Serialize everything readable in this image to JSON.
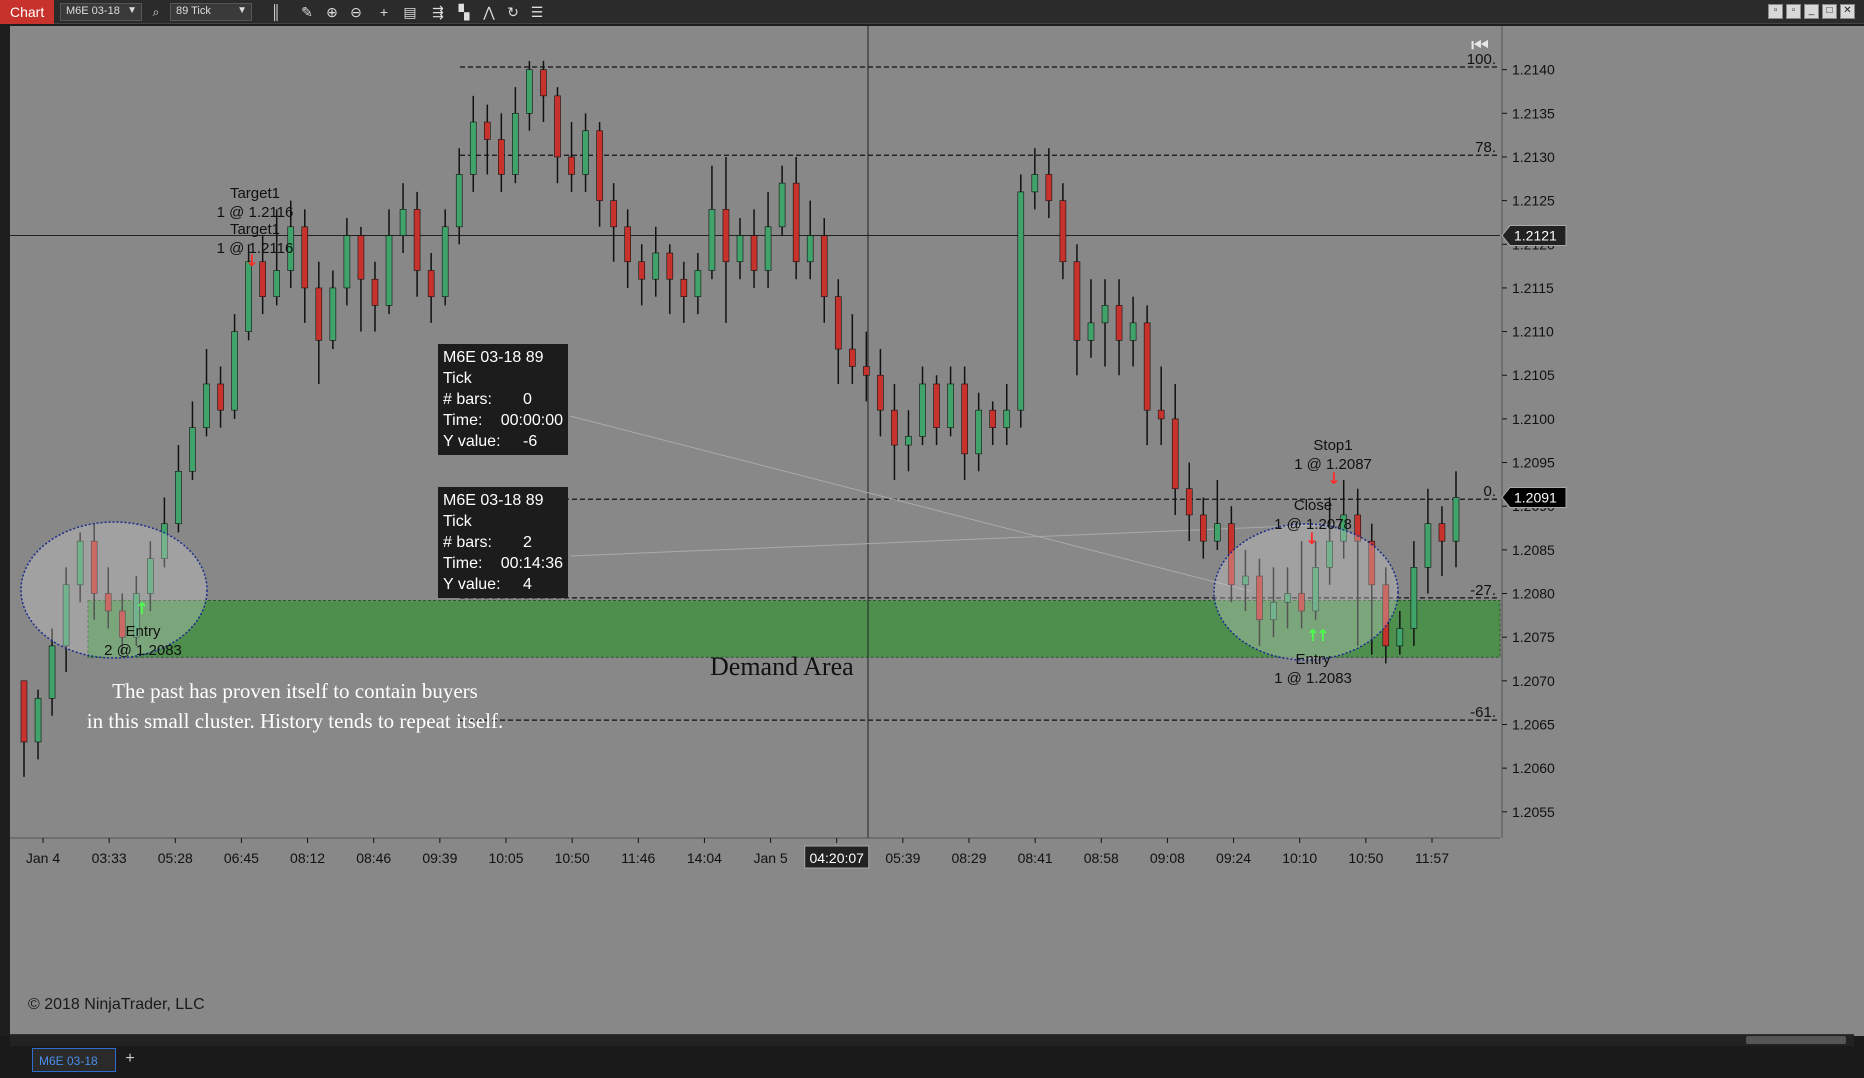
{
  "toolbar": {
    "chart_tab": "Chart",
    "instrument": "M6E 03-18",
    "period": "89 Tick",
    "icons": [
      "bar-type-icon",
      "pencil-icon",
      "zoom-in-icon",
      "zoom-out-icon",
      "crosshair-icon",
      "properties-icon",
      "strategies-icon",
      "indicators-icon",
      "drawing-tools-icon",
      "refresh-icon",
      "list-icon"
    ],
    "window_buttons": [
      "restore",
      "tile",
      "minimize",
      "maximize",
      "close"
    ]
  },
  "colors": {
    "up": "#3fa36a",
    "down": "#c8322c",
    "background": "#888888",
    "demand_area": "#4e8f4e"
  },
  "chart_data": {
    "type": "candlestick",
    "y_ticks": [
      "1.2140",
      "1.2135",
      "1.2130",
      "1.2125",
      "1.2120",
      "1.2115",
      "1.2110",
      "1.2105",
      "1.2100",
      "1.2095",
      "1.2090",
      "1.2085",
      "1.2080",
      "1.2075",
      "1.2070",
      "1.2065",
      "1.2060",
      "1.2055"
    ],
    "ylim": [
      1.2052,
      1.2145
    ],
    "x_ticks": [
      "Jan 4",
      "03:33",
      "05:28",
      "06:45",
      "08:12",
      "08:46",
      "09:39",
      "10:05",
      "10:50",
      "11:46",
      "14:04",
      "Jan 5",
      "04:20:07",
      "05:39",
      "08:29",
      "08:41",
      "08:58",
      "09:08",
      "09:24",
      "10:10",
      "10:50",
      "11:57"
    ],
    "price_marker": "1.2121",
    "last_price": "1.2091",
    "fib_labels": [
      "100.",
      "78.",
      "0.",
      "-27.",
      "-61."
    ],
    "fib_levels": [
      1.21403,
      1.21302,
      1.20908,
      1.20795,
      1.20655
    ],
    "demand_area": {
      "label": "Demand Area",
      "low": 1.20727,
      "high": 1.20792
    },
    "candles": [
      [
        1.207,
        1.2063,
        1.2068,
        1.2059
      ],
      [
        1.2063,
        1.2068,
        1.2069,
        1.2061
      ],
      [
        1.2068,
        1.2074,
        1.2076,
        1.2066
      ],
      [
        1.2074,
        1.2081,
        1.2083,
        1.2071
      ],
      [
        1.2081,
        1.2086,
        1.2087,
        1.2079
      ],
      [
        1.2086,
        1.208,
        1.2088,
        1.2077
      ],
      [
        1.208,
        1.2078,
        1.2083,
        1.2076
      ],
      [
        1.2078,
        1.2075,
        1.208,
        1.2073
      ],
      [
        1.2075,
        1.208,
        1.2082,
        1.2074
      ],
      [
        1.208,
        1.2084,
        1.2086,
        1.2078
      ],
      [
        1.2084,
        1.2088,
        1.2091,
        1.2083
      ],
      [
        1.2088,
        1.2094,
        1.2097,
        1.2087
      ],
      [
        1.2094,
        1.2099,
        1.2102,
        1.2093
      ],
      [
        1.2099,
        1.2104,
        1.2108,
        1.2098
      ],
      [
        1.2104,
        1.2101,
        1.2106,
        1.2099
      ],
      [
        1.2101,
        1.211,
        1.2112,
        1.21
      ],
      [
        1.211,
        1.2118,
        1.212,
        1.2109
      ],
      [
        1.2118,
        1.2114,
        1.2121,
        1.2112
      ],
      [
        1.2114,
        1.2117,
        1.2124,
        1.2113
      ],
      [
        1.2117,
        1.2122,
        1.2125,
        1.2115
      ],
      [
        1.2122,
        1.2115,
        1.2124,
        1.2111
      ],
      [
        1.2115,
        1.2109,
        1.2118,
        1.2104
      ],
      [
        1.2109,
        1.2115,
        1.2117,
        1.2108
      ],
      [
        1.2115,
        1.2121,
        1.2123,
        1.2113
      ],
      [
        1.2121,
        1.2116,
        1.2122,
        1.211
      ],
      [
        1.2116,
        1.2113,
        1.2118,
        1.211
      ],
      [
        1.2113,
        1.2121,
        1.2124,
        1.2112
      ],
      [
        1.2121,
        1.2124,
        1.2127,
        1.2119
      ],
      [
        1.2124,
        1.2117,
        1.2126,
        1.2114
      ],
      [
        1.2117,
        1.2114,
        1.2119,
        1.2111
      ],
      [
        1.2114,
        1.2122,
        1.2124,
        1.2113
      ],
      [
        1.2122,
        1.2128,
        1.2131,
        1.212
      ],
      [
        1.2128,
        1.2134,
        1.2137,
        1.2126
      ],
      [
        1.2134,
        1.2132,
        1.2136,
        1.2128
      ],
      [
        1.2132,
        1.2128,
        1.2135,
        1.2126
      ],
      [
        1.2128,
        1.2135,
        1.2138,
        1.2127
      ],
      [
        1.2135,
        1.214,
        1.2141,
        1.2133
      ],
      [
        1.214,
        1.2137,
        1.2141,
        1.2134
      ],
      [
        1.2137,
        1.213,
        1.2138,
        1.2127
      ],
      [
        1.213,
        1.2128,
        1.2134,
        1.2126
      ],
      [
        1.2128,
        1.2133,
        1.2135,
        1.2126
      ],
      [
        1.2133,
        1.2125,
        1.2134,
        1.2122
      ],
      [
        1.2125,
        1.2122,
        1.2127,
        1.2118
      ],
      [
        1.2122,
        1.2118,
        1.2124,
        1.2115
      ],
      [
        1.2118,
        1.2116,
        1.212,
        1.2113
      ],
      [
        1.2116,
        1.2119,
        1.2122,
        1.2114
      ],
      [
        1.2119,
        1.2116,
        1.212,
        1.2112
      ],
      [
        1.2116,
        1.2114,
        1.2118,
        1.2111
      ],
      [
        1.2114,
        1.2117,
        1.2119,
        1.2112
      ],
      [
        1.2117,
        1.2124,
        1.2129,
        1.2116
      ],
      [
        1.2124,
        1.2118,
        1.213,
        1.2111
      ],
      [
        1.2118,
        1.2121,
        1.2123,
        1.2116
      ],
      [
        1.2121,
        1.2117,
        1.2124,
        1.2115
      ],
      [
        1.2117,
        1.2122,
        1.2126,
        1.2115
      ],
      [
        1.2122,
        1.2127,
        1.2129,
        1.2121
      ],
      [
        1.2127,
        1.2118,
        1.213,
        1.2116
      ],
      [
        1.2118,
        1.2121,
        1.2125,
        1.2116
      ],
      [
        1.2121,
        1.2114,
        1.2123,
        1.2111
      ],
      [
        1.2114,
        1.2108,
        1.2116,
        1.2104
      ],
      [
        1.2108,
        1.2106,
        1.2112,
        1.2104
      ],
      [
        1.2106,
        1.2105,
        1.211,
        1.2102
      ],
      [
        1.2105,
        1.2101,
        1.2108,
        1.2098
      ],
      [
        1.2101,
        1.2097,
        1.2104,
        1.2093
      ],
      [
        1.2097,
        1.2098,
        1.2101,
        1.2094
      ],
      [
        1.2098,
        1.2104,
        1.2106,
        1.2097
      ],
      [
        1.2104,
        1.2099,
        1.2105,
        1.2097
      ],
      [
        1.2099,
        1.2104,
        1.2106,
        1.2098
      ],
      [
        1.2104,
        1.2096,
        1.2106,
        1.2093
      ],
      [
        1.2096,
        1.2101,
        1.2103,
        1.2094
      ],
      [
        1.2101,
        1.2099,
        1.2102,
        1.2097
      ],
      [
        1.2099,
        1.2101,
        1.2104,
        1.2097
      ],
      [
        1.2101,
        1.2126,
        1.2128,
        1.2099
      ],
      [
        1.2126,
        1.2128,
        1.2131,
        1.2124
      ],
      [
        1.2128,
        1.2125,
        1.2131,
        1.2123
      ],
      [
        1.2125,
        1.2118,
        1.2127,
        1.2116
      ],
      [
        1.2118,
        1.2109,
        1.212,
        1.2105
      ],
      [
        1.2109,
        1.2111,
        1.2116,
        1.2107
      ],
      [
        1.2111,
        1.2113,
        1.2116,
        1.2106
      ],
      [
        1.2113,
        1.2109,
        1.2116,
        1.2105
      ],
      [
        1.2109,
        1.2111,
        1.2114,
        1.2106
      ],
      [
        1.2111,
        1.2101,
        1.2113,
        1.2097
      ],
      [
        1.2101,
        1.21,
        1.2106,
        1.2097
      ],
      [
        1.21,
        1.2092,
        1.2104,
        1.2089
      ],
      [
        1.2092,
        1.2089,
        1.2095,
        1.2086
      ],
      [
        1.2089,
        1.2086,
        1.2091,
        1.2084
      ],
      [
        1.2086,
        1.2088,
        1.2093,
        1.2085
      ],
      [
        1.2088,
        1.2081,
        1.209,
        1.2079
      ],
      [
        1.2081,
        1.2082,
        1.2085,
        1.2078
      ],
      [
        1.2082,
        1.2077,
        1.2084,
        1.2074
      ],
      [
        1.2077,
        1.2079,
        1.2083,
        1.2075
      ],
      [
        1.2079,
        1.208,
        1.2083,
        1.2076
      ],
      [
        1.208,
        1.2078,
        1.2086,
        1.2076
      ],
      [
        1.2078,
        1.2083,
        1.2086,
        1.2077
      ],
      [
        1.2083,
        1.2086,
        1.2091,
        1.2081
      ],
      [
        1.2086,
        1.2089,
        1.2093,
        1.2084
      ],
      [
        1.2089,
        1.2086,
        1.2092,
        1.2074
      ],
      [
        1.2086,
        1.2081,
        1.2088,
        1.2073
      ],
      [
        1.2081,
        1.2074,
        1.2083,
        1.2072
      ],
      [
        1.2074,
        1.2076,
        1.2078,
        1.2073
      ],
      [
        1.2076,
        1.2083,
        1.2086,
        1.2074
      ],
      [
        1.2083,
        1.2088,
        1.2092,
        1.208
      ],
      [
        1.2088,
        1.2086,
        1.209,
        1.2082
      ],
      [
        1.2086,
        1.2091,
        1.2094,
        1.2083
      ]
    ]
  },
  "labels": {
    "copyright": "© 2018 NinjaTrader, LLC",
    "demand_area": "Demand Area",
    "comment_line1": "The past has proven itself to contain buyers",
    "comment_line2": "in this small cluster. History tends to repeat itself.",
    "target1_a_name": "Target1",
    "target1_a_qty": "1 @ 1.2116",
    "target1_b_name": "Target1",
    "target1_b_qty": "1 @ 1.2116",
    "entry_left_name": "Entry",
    "entry_left_qty": "2 @ 1.2083",
    "stop1_name": "Stop1",
    "stop1_qty": "1 @ 1.2087",
    "close_name": "Close",
    "close_qty": "1 @ 1.2078",
    "entry_right_name": "Entry",
    "entry_right_qty": "1 @ 1.2083"
  },
  "data_boxes": [
    {
      "title": "M6E 03-18 89 Tick",
      "bars_label": "# bars:",
      "bars": "0",
      "time_label": "Time:",
      "time": "00:00:00",
      "y_label": "Y value:",
      "y": "-6"
    },
    {
      "title": "M6E 03-18 89 Tick",
      "bars_label": "# bars:",
      "bars": "2",
      "time_label": "Time:",
      "time": "00:14:36",
      "y_label": "Y value:",
      "y": "4"
    }
  ],
  "bottom": {
    "instrument_tab": "M6E 03-18",
    "add_tab": "+"
  }
}
